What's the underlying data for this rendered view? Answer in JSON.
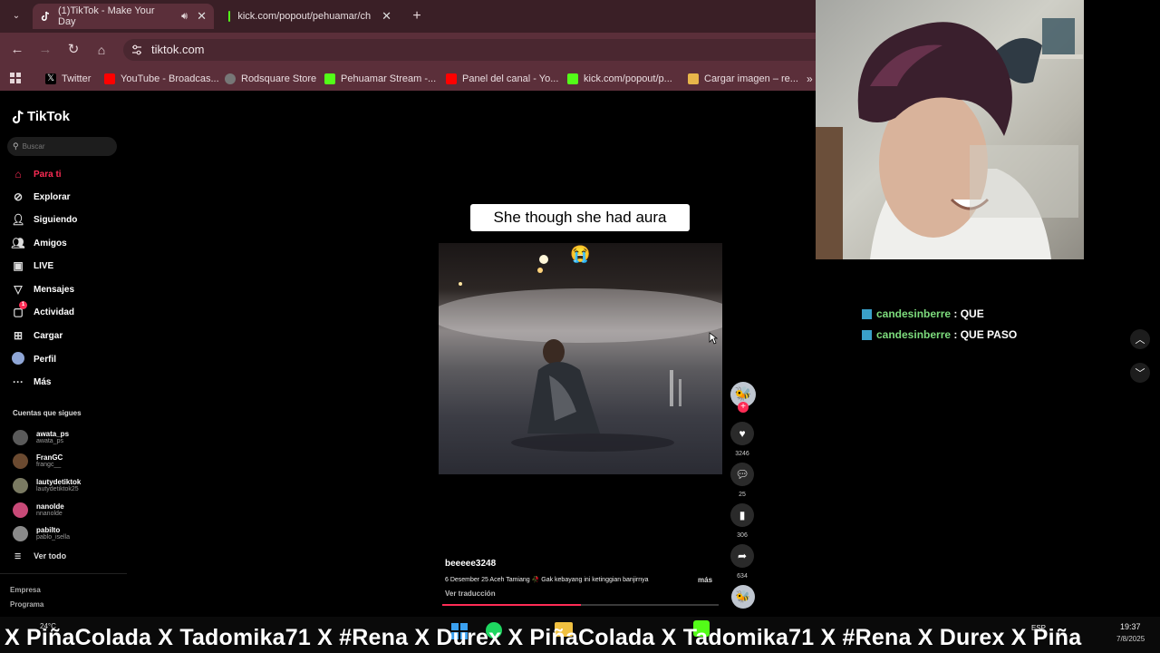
{
  "browser": {
    "tabs": [
      {
        "label": "(1)TikTok - Make Your Day",
        "active": true
      },
      {
        "label": "kick.com/popout/pehuamar/ch",
        "active": false
      }
    ],
    "url": "tiktok.com",
    "bookmarks": [
      "Twitter",
      "YouTube - Broadcas...",
      "Rodsquare Store",
      "Pehuamar Stream -...",
      "Panel del canal - Yo...",
      "kick.com/popout/p...",
      "Cargar imagen – re..."
    ]
  },
  "tiktok": {
    "logo": "TikTok",
    "search_placeholder": "Buscar",
    "nav": [
      "Para ti",
      "Explorar",
      "Siguiendo",
      "Amigos",
      "LIVE",
      "Mensajes",
      "Actividad",
      "Cargar",
      "Perfil",
      "Más"
    ],
    "activity_badge": "1",
    "following_header": "Cuentas que sigues",
    "following": [
      {
        "name": "awata_ps",
        "handle": "awata_ps"
      },
      {
        "name": "FranGC",
        "handle": "frangc__"
      },
      {
        "name": "lautydetiktok",
        "handle": "lautydetiktok25"
      },
      {
        "name": "nanolde",
        "handle": "nnanolde"
      },
      {
        "name": "pabilto",
        "handle": "pablo_isella"
      }
    ],
    "see_all": "Ver todo",
    "footer": [
      "Empresa",
      "Programa"
    ],
    "video": {
      "caption_overlay": "She though she had aura",
      "emoji": "😭",
      "author": "beeeee3248",
      "description": "6 Desember 25 Aceh Tamiang 🥀 Gak kebayang ini ketinggian banjirnya",
      "more": "más",
      "translate": "Ver traducción",
      "progress": 0.5
    },
    "actions": {
      "likes": "3246",
      "comments": "25",
      "saves": "306",
      "shares": "634"
    }
  },
  "chat": {
    "messages": [
      {
        "user": "candesinberre",
        "text": "QUE"
      },
      {
        "user": "candesinberre",
        "text": "QUE PASO"
      }
    ]
  },
  "ticker": {
    "text": "X PiñaColada  X  Tadomika71  X  #Rena  X  Durex  X  PiñaColada  X  Tadomika71  X  #Rena  X  Durex  X  Piña"
  },
  "taskbar": {
    "temperature": "24°C",
    "language": "ESP",
    "time": "19:37",
    "date": "7/8/2025"
  }
}
